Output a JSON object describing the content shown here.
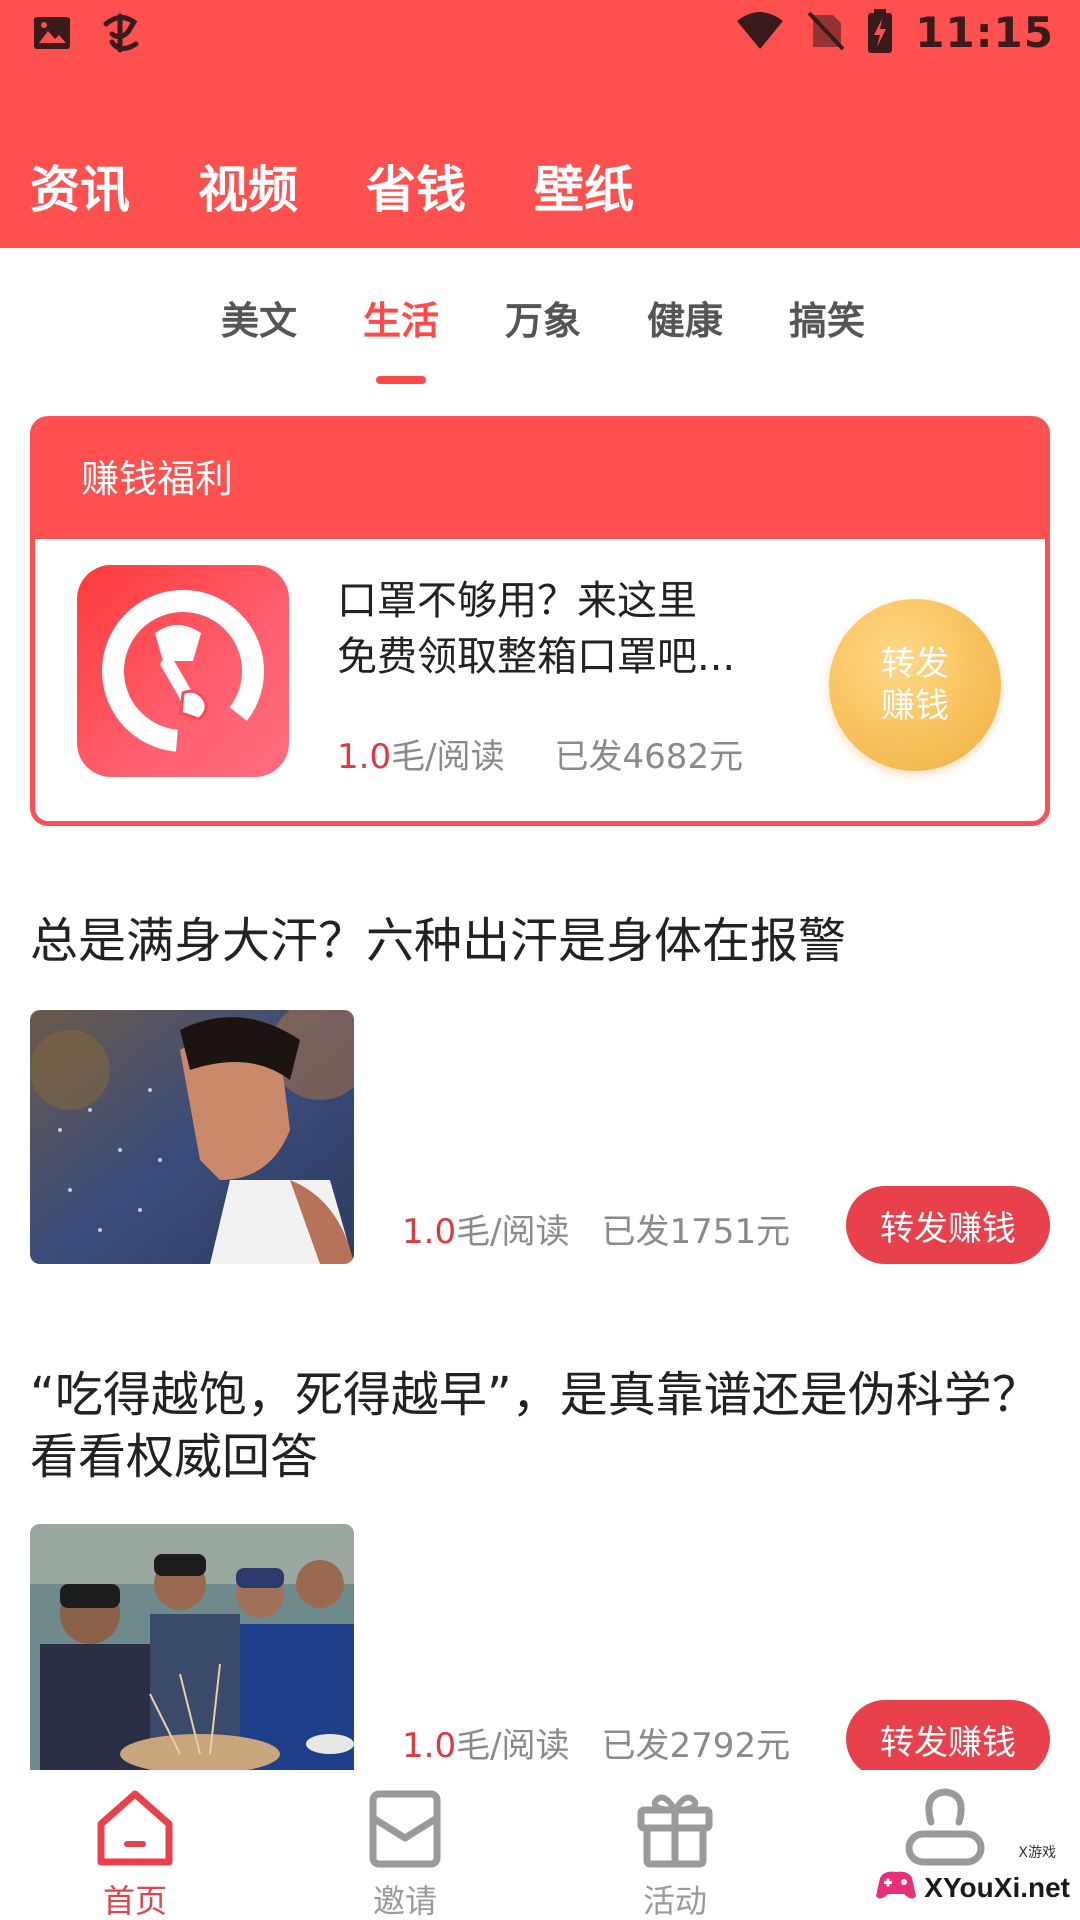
{
  "status_bar": {
    "time": "11:15",
    "icons": [
      "image-icon",
      "app-logo-icon",
      "wifi-icon",
      "no-sim-icon",
      "battery-charging-icon"
    ]
  },
  "header": {
    "tabs": [
      {
        "label": "资讯"
      },
      {
        "label": "视频"
      },
      {
        "label": "省钱"
      },
      {
        "label": "壁纸"
      }
    ]
  },
  "sub_tabs": {
    "items": [
      {
        "label": "美文"
      },
      {
        "label": "生活"
      },
      {
        "label": "万象"
      },
      {
        "label": "健康"
      },
      {
        "label": "搞笑"
      }
    ],
    "active": "生活"
  },
  "welfare": {
    "header": "赚钱福利",
    "title_line1": "口罩不够用？来这里",
    "title_line2": "免费领取整箱口罩吧...",
    "price": "1.0",
    "price_unit": "毛/阅读",
    "paid": "已发4682元",
    "button_line1": "转发",
    "button_line2": "赚钱"
  },
  "articles": [
    {
      "title": "总是满身大汗？六种出汗是身体在报警",
      "price": "1.0",
      "price_unit": "毛/阅读",
      "paid": "已发1751元",
      "button": "转发赚钱"
    },
    {
      "title": "“吃得越饱，死得越早”，是真靠谱还是伪科学？看看权威回答",
      "price": "1.0",
      "price_unit": "毛/阅读",
      "paid": "已发2792元",
      "button": "转发赚钱"
    }
  ],
  "bottom_nav": {
    "items": [
      {
        "label": "首页",
        "icon": "home-icon"
      },
      {
        "label": "邀请",
        "icon": "envelope-icon"
      },
      {
        "label": "活动",
        "icon": "gift-icon"
      },
      {
        "label": "",
        "icon": "user-icon"
      }
    ],
    "active": "首页"
  },
  "watermark": {
    "text": "XYouXi.net",
    "small": "X游戏"
  },
  "colors": {
    "brand_red": "#FF5050",
    "button_red": "#E8414C",
    "gold": "#F8C25C"
  }
}
